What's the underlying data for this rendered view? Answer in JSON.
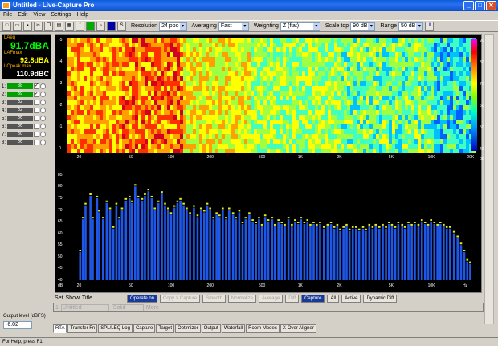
{
  "window": {
    "title": "Untitled - Live-Capture Pro",
    "min": "_",
    "max": "□",
    "close": "✕"
  },
  "menu": [
    "File",
    "Edit",
    "View",
    "Settings",
    "Help"
  ],
  "toolbar": {
    "resolution_label": "Resolution",
    "resolution_value": "24 ppo",
    "averaging_label": "Averaging",
    "averaging_value": "Fast",
    "weighting_label": "Weighting",
    "weighting_value": "Z (flat)",
    "scaletop_label": "Scale top",
    "scaletop_value": "90 dB",
    "range_label": "Range",
    "range_value": "50 dB"
  },
  "meters": {
    "laeq_label": "LAeq",
    "laeq_value": "91.7dBA",
    "lafmax_label": "LAFmax",
    "lafmax_value": "92.8dBA",
    "lcpeak_label": "LCpeak max",
    "lcpeak_value": "110.9dBC"
  },
  "channels": [
    {
      "n": "1:",
      "v": "88",
      "on": true,
      "checked": true
    },
    {
      "n": "2:",
      "v": "89",
      "on": true,
      "checked": true
    },
    {
      "n": "3:",
      "v": "52",
      "on": false,
      "checked": false
    },
    {
      "n": "4:",
      "v": "52",
      "on": false,
      "checked": false
    },
    {
      "n": "5:",
      "v": "56",
      "on": false,
      "checked": false
    },
    {
      "n": "6:",
      "v": "56",
      "on": false,
      "checked": false
    },
    {
      "n": "7:",
      "v": "60",
      "on": false,
      "checked": false
    },
    {
      "n": "8:",
      "v": "56",
      "on": false,
      "checked": false
    }
  ],
  "output": {
    "label": "Output level (dBFS)",
    "value": "-6.02"
  },
  "spectrogram": {
    "colorbar_labels": [
      "90",
      "80",
      "70",
      "60",
      "50",
      "40"
    ],
    "colorbar_unit": "dB",
    "time_labels": [
      "-5",
      "-4",
      "-3",
      "-2",
      "-1",
      "0"
    ],
    "x_labels": [
      "20",
      "50",
      "100",
      "200",
      "500",
      "1K",
      "2K",
      "5K",
      "10K",
      "20K"
    ],
    "x_unit": "Hz"
  },
  "rta": {
    "y_labels": [
      "85",
      "80",
      "75",
      "70",
      "65",
      "60",
      "55",
      "50",
      "45",
      "40"
    ],
    "y_unit": "dB",
    "x_labels": [
      "20",
      "50",
      "100",
      "200",
      "500",
      "1K",
      "2K",
      "5K",
      "10K"
    ],
    "x_unit": "Hz"
  },
  "controls": {
    "set": "Set",
    "show": "Show",
    "title": "Title",
    "operate": "Operate on",
    "copy": "Copy > Capture",
    "smooth": "Smooth",
    "normalize": "Normalize",
    "average": "Average",
    "diff": "Diff",
    "capture": "Capture",
    "all": "All",
    "active": "Active",
    "dyn": "Dynamic Diff"
  },
  "panel2": {
    "num": "1",
    "name": "Untitled",
    "style": "Solid",
    "more": "More"
  },
  "tabs": [
    "RTA",
    "Transfer Fn",
    "SPL/LEQ Log",
    "Capture",
    "Target",
    "Optimizer",
    "Output",
    "Waterfall",
    "Room Modes",
    "X-Over Aligner"
  ],
  "status": "For Help, press F1",
  "chart_data": {
    "type": "bar",
    "title": "",
    "xlabel": "",
    "ylabel": "",
    "x_unit": "Hz",
    "y_unit": "dB",
    "ylim": [
      40,
      88
    ],
    "x": [
      20,
      21,
      22,
      24,
      25,
      27,
      28,
      30,
      32,
      34,
      36,
      38,
      40,
      42,
      45,
      48,
      50,
      53,
      56,
      60,
      63,
      67,
      71,
      75,
      80,
      85,
      90,
      95,
      100,
      106,
      112,
      118,
      125,
      132,
      140,
      150,
      160,
      170,
      180,
      190,
      200,
      212,
      224,
      236,
      250,
      265,
      280,
      300,
      315,
      335,
      355,
      375,
      400,
      425,
      450,
      475,
      500,
      530,
      560,
      600,
      630,
      670,
      710,
      750,
      800,
      850,
      900,
      950,
      1000,
      1060,
      1120,
      1180,
      1250,
      1320,
      1400,
      1500,
      1600,
      1700,
      1800,
      1900,
      2000,
      2120,
      2240,
      2360,
      2500,
      2650,
      2800,
      3000,
      3150,
      3350,
      3550,
      3750,
      4000,
      4250,
      4500,
      4750,
      5000,
      5300,
      5600,
      6000,
      6300,
      6700,
      7100,
      7500,
      8000,
      8500,
      9000,
      9500,
      10000,
      10600,
      11200,
      11800,
      12500,
      13200,
      14000,
      15000,
      16000,
      17000,
      18000,
      19000,
      20000
    ],
    "series": [
      {
        "values": [
          52,
          66,
          72,
          76,
          66,
          75,
          69,
          66,
          73,
          70,
          62,
          72,
          66,
          70,
          74,
          75,
          73,
          80,
          75,
          74,
          76,
          78,
          75,
          70,
          73,
          77,
          72,
          70,
          68,
          71,
          73,
          74,
          72,
          70,
          68,
          71,
          67,
          70,
          69,
          72,
          70,
          66,
          68,
          67,
          70,
          66,
          70,
          68,
          66,
          69,
          64,
          66,
          68,
          65,
          64,
          66,
          63,
          67,
          65,
          66,
          63,
          65,
          64,
          63,
          66,
          63,
          65,
          64,
          66,
          64,
          65,
          63,
          64,
          63,
          64,
          62,
          63,
          64,
          62,
          63,
          61,
          62,
          63,
          61,
          62,
          62,
          61,
          62,
          61,
          63,
          62,
          63,
          62,
          63,
          62,
          64,
          63,
          62,
          64,
          63,
          62,
          64,
          63,
          64,
          63,
          65,
          64,
          63,
          65,
          64,
          63,
          64,
          63,
          62,
          62,
          60,
          58,
          55,
          52,
          48,
          47
        ]
      }
    ],
    "grid": false
  }
}
